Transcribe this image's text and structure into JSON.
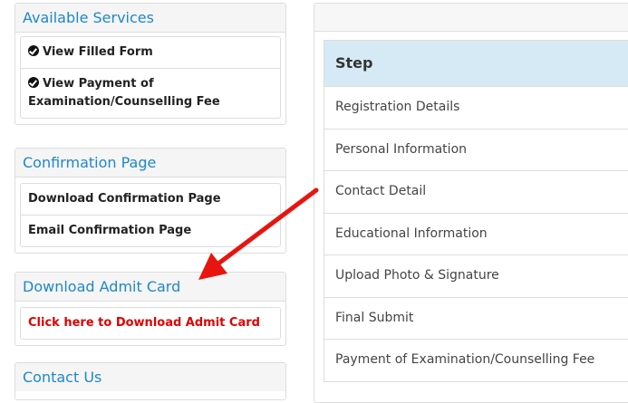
{
  "available_services": {
    "title": "Available Services",
    "items": [
      {
        "label": "View Filled Form",
        "icon": "check-circle-icon"
      },
      {
        "label_line1": "View Payment of",
        "label_line2": "Examination/Counselling Fee",
        "icon": "check-circle-icon"
      }
    ]
  },
  "confirmation": {
    "title": "Confirmation Page",
    "items": [
      "Download Confirmation Page",
      "Email Confirmation Page"
    ]
  },
  "admit_card": {
    "title": "Download Admit Card",
    "link": "Click here to Download Admit Card",
    "link_color": "#e00000"
  },
  "contact": {
    "title": "Contact Us"
  },
  "steps": {
    "header": "Step",
    "rows": [
      "Registration Details",
      "Personal Information",
      "Contact Detail",
      "Educational Information",
      "Upload Photo & Signature",
      "Final Submit",
      "Payment of Examination/Counselling Fee"
    ]
  },
  "colors": {
    "accent": "#1e88c9",
    "step_header_bg": "#d6eaf6",
    "annotation_arrow": "#e8140f"
  }
}
